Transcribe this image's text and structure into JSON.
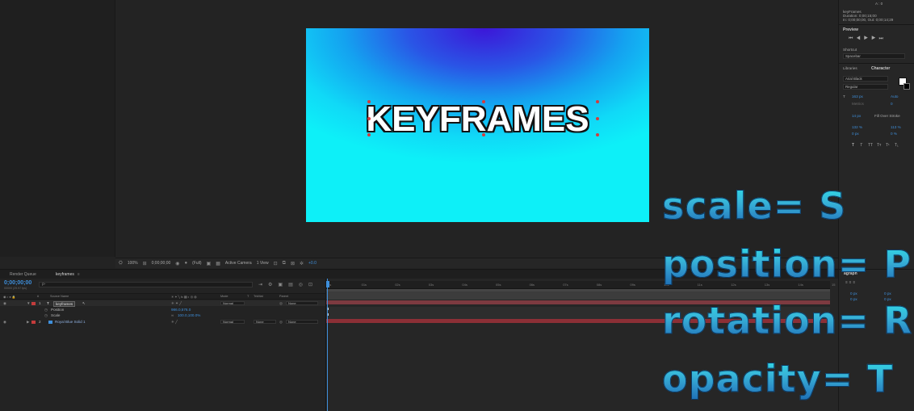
{
  "viewer": {
    "comp_text": "KEYFRAMES",
    "bar": {
      "zoom": "100%",
      "timecode": "0;00;00;00",
      "resolution": "(Full)",
      "camera": "Active Camera",
      "views": "1 View",
      "exposure": "+0.0"
    }
  },
  "info_panel": {
    "top_value": "A : 0",
    "comp_name": "keyFrames",
    "duration": "Duration: 0;00;15;00",
    "in_out": "In: 0;00;00;00, Out: 0;00;14;29"
  },
  "preview_panel": {
    "title": "Preview",
    "shortcut_label": "Shortcut",
    "shortcut_value": "Spacebar"
  },
  "character_panel": {
    "tab_libraries": "Libraries",
    "tab_character": "Character",
    "font_family": "Arial Black",
    "font_style": "Regular",
    "font_size": "163 px",
    "leading": "Auto",
    "kerning": "Metrics",
    "tracking": "0",
    "stroke_width": "14 px",
    "stroke_type": "Fill Over Stroke",
    "vert_scale": "132 %",
    "horiz_scale": "113 %",
    "baseline": "0 px",
    "tsume": "0 %",
    "style_buttons": [
      "T",
      "T",
      "TT",
      "Tт",
      "T¹",
      "T₁"
    ]
  },
  "paragraph_panel": {
    "title": "agraph",
    "indent_values": [
      "0 px",
      "0 px",
      "0 px",
      "0 px"
    ]
  },
  "timeline": {
    "tabs": [
      {
        "label": "Render Queue"
      },
      {
        "label": "keyframes"
      }
    ],
    "timecode": "0;00;00;00",
    "timecode_sub": "00000 (29.97 fps)",
    "search_placeholder": "ρ-",
    "col_headers": {
      "num": "#",
      "source": "Source Name",
      "mode": "Mode",
      "t": "T",
      "trkmat": "TrkMat",
      "parent": "Parent"
    },
    "layers": [
      {
        "num": "1",
        "name": "keyframes",
        "mode": "Normal",
        "trkmat": "",
        "parent": "None",
        "color": "#c43c3c"
      },
      {
        "num": "2",
        "name": "Royal Blue Solid 1",
        "mode": "Normal",
        "trkmat": "None",
        "parent": "None",
        "color": "#c43c3c"
      }
    ],
    "properties": [
      {
        "name": "Position",
        "value": "986.0,576.0"
      },
      {
        "name": "Scale",
        "value": "100.0,100.0%"
      }
    ],
    "ruler_ticks": [
      "0s",
      "01s",
      "02s",
      "03s",
      "04s",
      "05s",
      "06s",
      "07s",
      "08s",
      "09s",
      "10s",
      "11s",
      "12s",
      "13s",
      "14s",
      "15"
    ]
  },
  "overlay": {
    "lines": [
      "scale= S",
      "position= P",
      "rotation= R",
      "opacity= T"
    ]
  },
  "colors": {
    "accent_blue": "#3e8fdb",
    "layer_label_red": "#c43c3c",
    "track_red": "#8c2f36",
    "overlay_cyan": "#2ee0e8"
  }
}
